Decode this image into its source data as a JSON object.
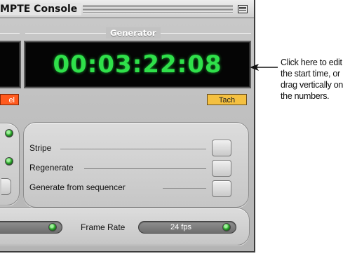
{
  "window": {
    "title": "MPTE Console"
  },
  "generator": {
    "section_title": "Generator",
    "timecode": "00:03:22:08",
    "tach_label": "Tach"
  },
  "reader": {
    "red_button_label_fragment": "el"
  },
  "stripe_panel": {
    "rows": [
      {
        "label": "Stripe"
      },
      {
        "label": "Regenerate"
      },
      {
        "label": "Generate from sequencer"
      }
    ]
  },
  "bottom_bar": {
    "frame_rate_label": "Frame Rate",
    "frame_rate_value": "24 fps"
  },
  "callout": {
    "lines": [
      "Click here to edit",
      "the start time, or",
      "drag vertically on",
      "the numbers."
    ]
  },
  "colors": {
    "lcd_digits": "#2fe04a",
    "tach_button": "#f4c040",
    "red_button": "#ff5a1e",
    "led_green": "#2fae2f"
  }
}
